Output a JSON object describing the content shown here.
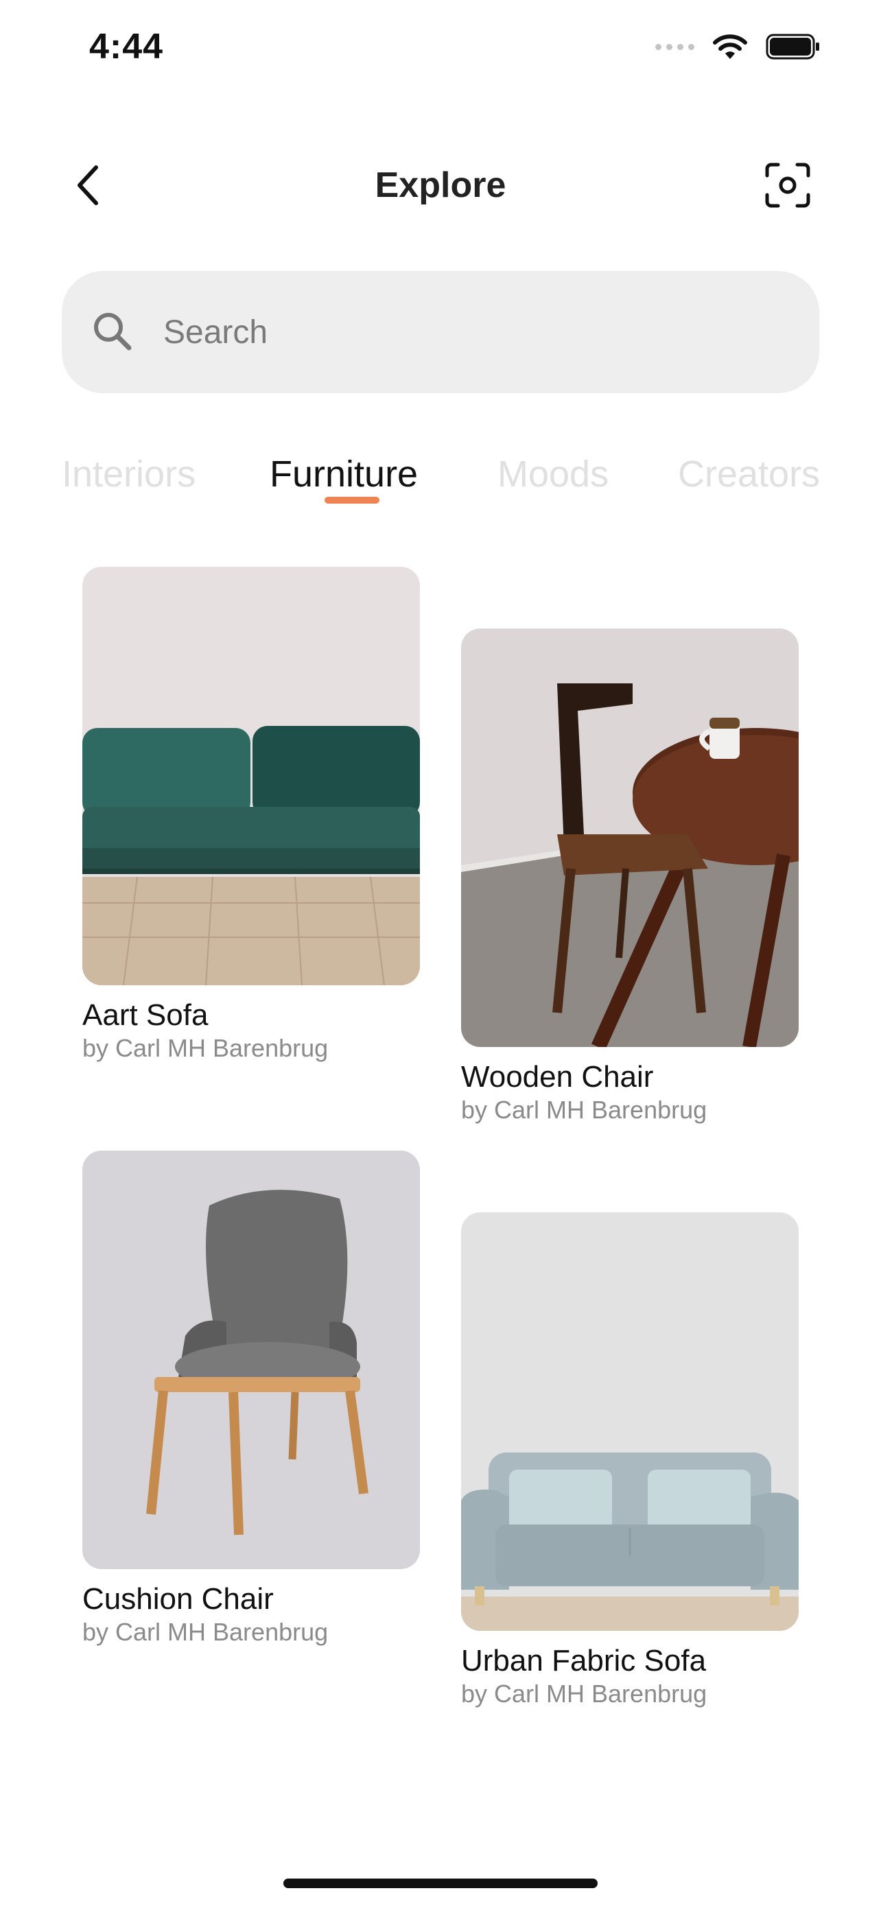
{
  "status_bar": {
    "time": "4:44"
  },
  "header": {
    "title": "Explore"
  },
  "search": {
    "placeholder": "Search"
  },
  "tabs": [
    {
      "label": "Interiors",
      "active": false
    },
    {
      "label": "Furniture",
      "active": true
    },
    {
      "label": "Moods",
      "active": false
    },
    {
      "label": "Creators",
      "active": false
    }
  ],
  "colors": {
    "accent": "#ef8452",
    "search_bg": "#eeeeee"
  },
  "products": [
    {
      "title": "Aart Sofa",
      "author": "by Carl MH Barenbrug"
    },
    {
      "title": "Wooden Chair",
      "author": "by Carl MH Barenbrug"
    },
    {
      "title": "Cushion Chair",
      "author": "by Carl MH Barenbrug"
    },
    {
      "title": "Urban Fabric Sofa",
      "author": "by Carl MH Barenbrug"
    }
  ]
}
